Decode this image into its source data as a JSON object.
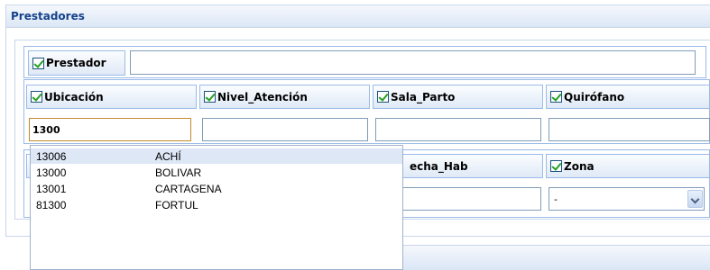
{
  "panel": {
    "title": "Prestadores"
  },
  "prestador": {
    "label": "Prestador",
    "value": ""
  },
  "columns": [
    {
      "label": "Ubicación",
      "value": "1300"
    },
    {
      "label": "Nivel_Atención",
      "value": ""
    },
    {
      "label": "Sala_Parto",
      "value": ""
    },
    {
      "label": "Quirófano",
      "value": ""
    }
  ],
  "row2": {
    "fecha_label_partial": "echa_Hab",
    "fecha_value": "",
    "zona_label": "Zona",
    "zona_value": "-"
  },
  "autocomplete": [
    {
      "code": "13006",
      "name": "ACHÍ"
    },
    {
      "code": "13000",
      "name": "BOLIVAR"
    },
    {
      "code": "13001",
      "name": "CARTAGENA"
    },
    {
      "code": "81300",
      "name": "FORTUL"
    }
  ]
}
